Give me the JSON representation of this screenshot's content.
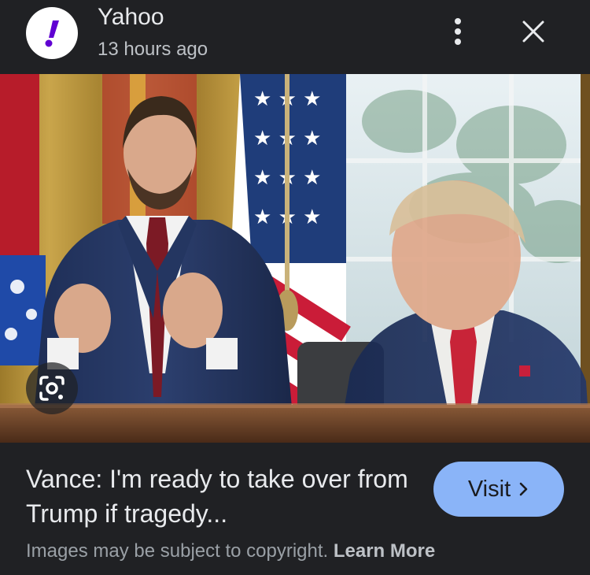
{
  "header": {
    "source_name": "Yahoo",
    "timestamp": "13 hours ago",
    "logo_icon": "yahoo-exclamation-icon",
    "logo_color": "#6001d2",
    "more_icon": "more-vertical-icon",
    "close_icon": "close-icon"
  },
  "image": {
    "lens_icon": "google-lens-icon"
  },
  "article": {
    "headline": "Vance: I'm ready to take over from Trump if tragedy...",
    "visit_label": "Visit",
    "visit_icon": "chevron-right-icon",
    "visit_color": "#8ab4f8"
  },
  "footer": {
    "copyright_text": "Images may be subject to copyright.",
    "learn_more_label": "Learn More"
  }
}
